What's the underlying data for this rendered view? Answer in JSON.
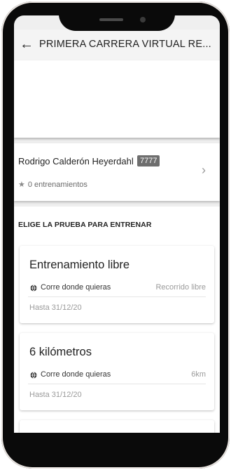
{
  "header": {
    "title": "PRIMERA CARRERA VIRTUAL RE..."
  },
  "user": {
    "name": "Rodrigo Calderón Heyerdahl",
    "bib": "7777",
    "trainings": "0 entrenamientos"
  },
  "section": {
    "title": "ELIGE LA PRUEBA PARA ENTRENAR"
  },
  "races": [
    {
      "title": "Entrenamiento libre",
      "location": "Corre donde quieras",
      "distance": "Recorrido libre",
      "deadline": "Hasta 31/12/20"
    },
    {
      "title": "6 kilómetros",
      "location": "Corre donde quieras",
      "distance": "6km",
      "deadline": "Hasta 31/12/20"
    }
  ],
  "icons": {
    "back": "arrow-left-icon",
    "chevron": "chevron-right-icon",
    "star": "star-icon",
    "globe": "globe-icon"
  },
  "colors": {
    "badge": "#6e6e6e",
    "background": "#efefef"
  }
}
